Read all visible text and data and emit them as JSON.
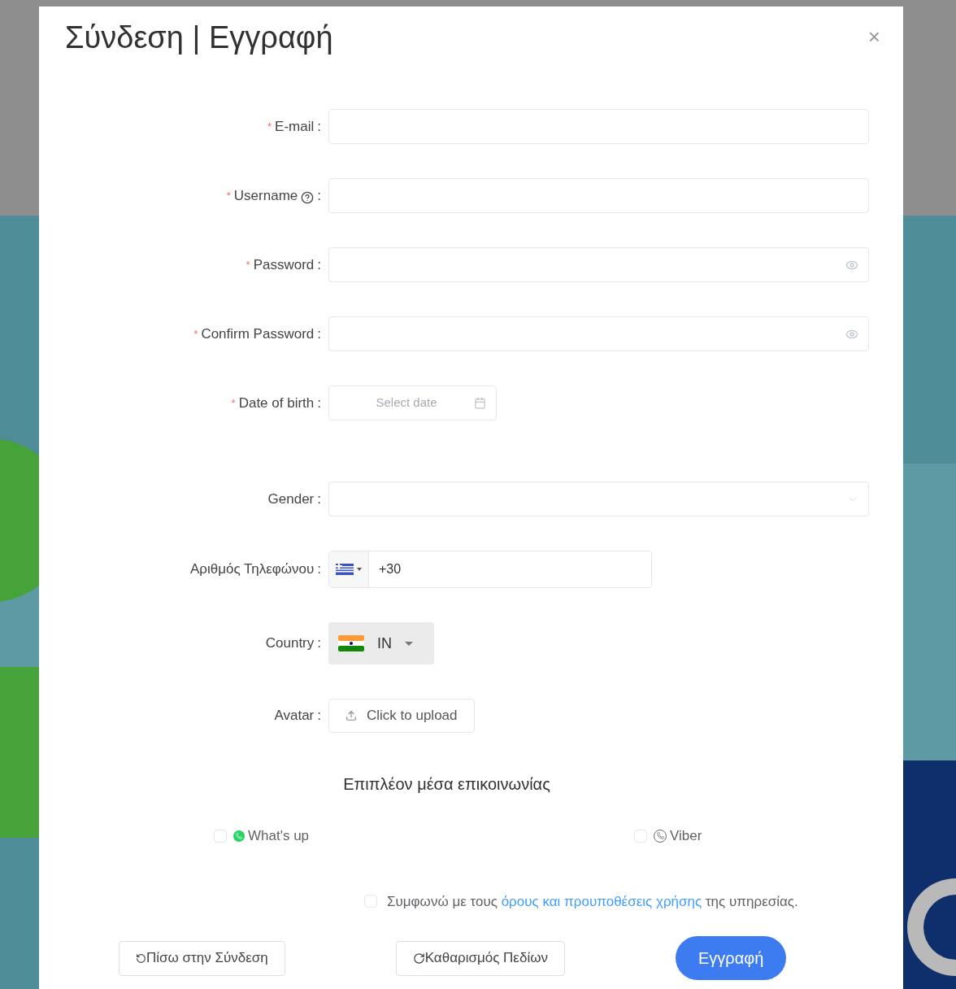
{
  "dialog": {
    "title": "Σύνδεση | Εγγραφή",
    "close": "×"
  },
  "fields": [
    {
      "kind": "text",
      "label": "E-mail",
      "required_mark": "*",
      "colon": ":"
    },
    {
      "kind": "text",
      "label": "Username",
      "required_mark": "*",
      "help": true,
      "colon": ":"
    },
    {
      "kind": "password",
      "label": "Password",
      "required_mark": "*",
      "colon": ":"
    },
    {
      "kind": "password",
      "label": "Confirm Password",
      "required_mark": "*",
      "colon": ":"
    },
    {
      "kind": "date",
      "label": "Date of birth",
      "required_mark": "*",
      "colon": ":",
      "placeholder": "Select date"
    },
    {
      "kind": "select",
      "label": "Gender",
      "colon": ":"
    },
    {
      "kind": "phone",
      "label": "Αριθμός Τηλεφώνου",
      "colon": ":",
      "value": "+30"
    },
    {
      "kind": "country",
      "label": "Country",
      "colon": ":",
      "value": "IN"
    },
    {
      "kind": "upload",
      "label": "Avatar",
      "colon": ":",
      "button": "Click to upload"
    }
  ],
  "contact": {
    "heading": "Επιπλέον μέσα επικοινωνίας",
    "options": [
      {
        "kind": "whatsapp",
        "label": "What's up",
        "checked": false
      },
      {
        "kind": "viber",
        "label": "Viber",
        "checked": false
      }
    ]
  },
  "terms": {
    "checked": false,
    "before": "Συμφωνώ με τους",
    "link": "όρους και προυποθέσεις χρήσης",
    "after": "της υπηρεσίας."
  },
  "buttons": [
    {
      "kind": "back",
      "label": "Πίσω στην Σύνδεση"
    },
    {
      "kind": "reset",
      "label": "Καθαρισμός Πεδίων"
    },
    {
      "kind": "primary",
      "label": "Εγγραφή"
    }
  ]
}
